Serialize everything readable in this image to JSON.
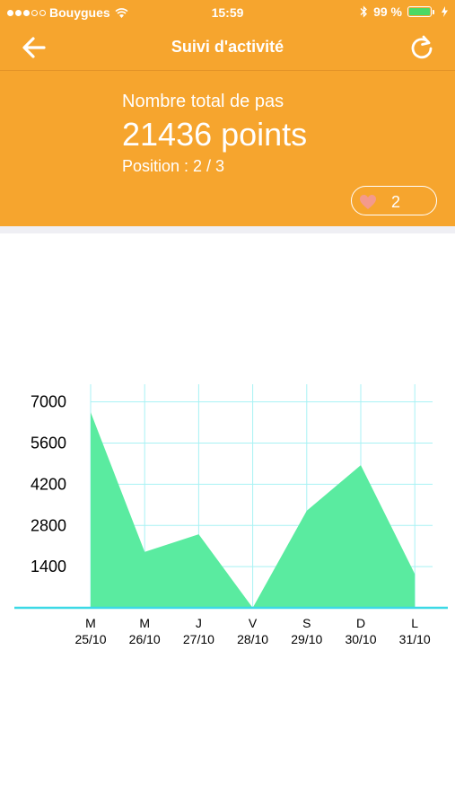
{
  "status_bar": {
    "carrier": "Bouygues",
    "time": "15:59",
    "battery": "99 %",
    "signal_bars_filled": 3,
    "signal_bars_total": 5
  },
  "nav": {
    "title": "Suivi d'activité",
    "back_icon": "arrow-left-icon",
    "refresh_icon": "refresh-icon"
  },
  "summary": {
    "label": "Nombre total de pas",
    "value": "21436 points",
    "position": "Position : 2 / 3"
  },
  "likes": {
    "icon": "heart-icon",
    "count": "2"
  },
  "colors": {
    "header": "#f6a52e",
    "area_fill": "#5aeba0",
    "grid": "#a8f2f4",
    "axis": "#3cd9e6",
    "heart": "#f49a8c",
    "battery_fill": "#4cd964"
  },
  "chart_data": {
    "type": "area",
    "categories": [
      "M\n25/10",
      "M\n26/10",
      "J\n27/10",
      "V\n28/10",
      "S\n29/10",
      "D\n30/10",
      "L\n31/10"
    ],
    "x_day_labels": [
      "M",
      "M",
      "J",
      "V",
      "S",
      "D",
      "L"
    ],
    "x_date_labels": [
      "25/10",
      "26/10",
      "27/10",
      "28/10",
      "29/10",
      "30/10",
      "31/10"
    ],
    "values": [
      6650,
      1900,
      2500,
      0,
      3300,
      4850,
      1150
    ],
    "yticks": [
      1400,
      2800,
      4200,
      5600,
      7000
    ],
    "ylim": [
      0,
      7600
    ],
    "grid": true,
    "legend": "none"
  }
}
